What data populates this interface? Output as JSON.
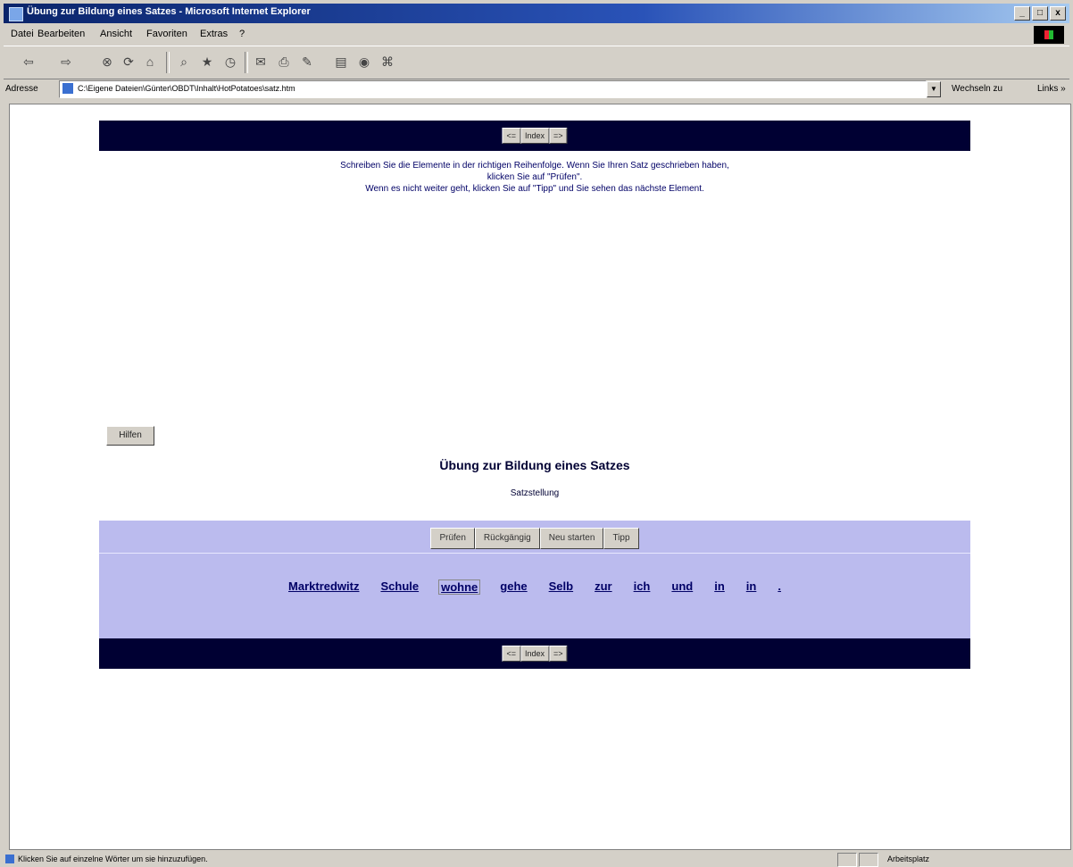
{
  "window": {
    "title": "Übung zur Bildung eines Satzes - Microsoft Internet Explorer",
    "controls": [
      "_",
      "□",
      "x"
    ]
  },
  "menu": [
    "Datei",
    "Bearbeiten",
    "Ansicht",
    "Favoriten",
    "Extras",
    "?"
  ],
  "toolbar": {
    "icons": [
      "back-icon",
      "forward-icon",
      "stop-icon",
      "refresh-icon",
      "home-icon",
      "search-icon",
      "favorites-icon",
      "history-icon",
      "mail-icon",
      "print-icon",
      "edit-icon",
      "discuss-icon",
      "messenger-icon"
    ]
  },
  "address": {
    "label": "Adresse",
    "url": "C:\\Eigene Dateien\\Günter\\OBDT\\Inhalt\\HotPotatoes\\satz.htm",
    "go_label": "Wechseln zu",
    "links_label": "Links »"
  },
  "nav": {
    "prev": "<=",
    "index": "Index",
    "next": "=>"
  },
  "instructions": {
    "line1": "Schreiben Sie die Elemente in der richtigen Reihenfolge. Wenn Sie Ihren Satz geschrieben haben,",
    "line2": "klicken Sie auf \"Prüfen\".",
    "line3": "Wenn es nicht weiter geht, klicken Sie auf \"Tipp\" und Sie sehen das nächste Element."
  },
  "help_button": "Hilfen",
  "exercise": {
    "title": "Übung zur Bildung eines Satzes",
    "subtitle": "Satzstellung",
    "buttons": [
      "Prüfen",
      "Rückgängig",
      "Neu starten",
      "Tipp"
    ],
    "words": [
      "Marktredwitz",
      "Schule",
      "wohne",
      "gehe",
      "Selb",
      "zur",
      "ich",
      "und",
      "in",
      "in",
      "."
    ]
  },
  "status": {
    "text": "Klicken Sie auf einzelne Wörter um sie hinzuzufügen.",
    "zone": "Arbeitsplatz"
  },
  "colors": {
    "navbar": "#000033",
    "exercise_bg": "#bbbbee",
    "text": "#000066"
  }
}
